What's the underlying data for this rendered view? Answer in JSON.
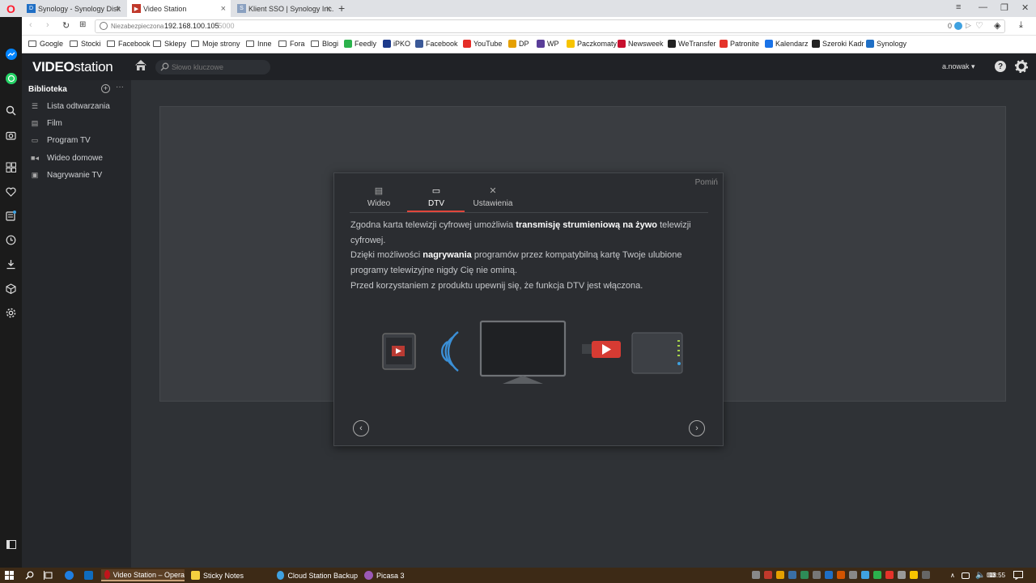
{
  "browser": {
    "tabs": [
      {
        "title": "Synology - Synology Disk",
        "favicon_color": "#1f6fc5"
      },
      {
        "title": "Video Station",
        "favicon_color": "#c0392b"
      },
      {
        "title": "Klient SSO | Synology Inc.",
        "favicon_color": "#8aa0c0"
      }
    ],
    "new_tab": "+",
    "url_security": "Niezabezpieczona",
    "url_host": "192.168.100.105",
    "url_port": ":5000",
    "url_badge": "0",
    "bookmarks": [
      {
        "label": "Google",
        "icon": "folder-icon"
      },
      {
        "label": "Stocki",
        "icon": "folder-icon"
      },
      {
        "label": "Facebook",
        "icon": "folder-icon"
      },
      {
        "label": "Sklepy",
        "icon": "folder-icon"
      },
      {
        "label": "Moje strony",
        "icon": "folder-icon"
      },
      {
        "label": "Inne",
        "icon": "folder-icon"
      },
      {
        "label": "Fora",
        "icon": "folder-icon"
      },
      {
        "label": "Blogi",
        "icon": "folder-icon"
      },
      {
        "label": "Feedly",
        "icon": "feedly-icon",
        "color": "#2bb24c"
      },
      {
        "label": "iPKO",
        "icon": "ipko-icon",
        "color": "#1d3b8b"
      },
      {
        "label": "Facebook",
        "icon": "facebook-icon",
        "color": "#3b5998"
      },
      {
        "label": "YouTube",
        "icon": "youtube-icon",
        "color": "#e52d27"
      },
      {
        "label": "DP",
        "icon": "dp-icon",
        "color": "#e5a000"
      },
      {
        "label": "WP",
        "icon": "wp-icon",
        "color": "#5a3e99"
      },
      {
        "label": "Paczkomaty",
        "icon": "paczkomaty-icon",
        "color": "#f7c400"
      },
      {
        "label": "Newsweek",
        "icon": "newsweek-icon",
        "color": "#c8102e"
      },
      {
        "label": "WeTransfer",
        "icon": "wetransfer-icon",
        "color": "#222222"
      },
      {
        "label": "Patronite",
        "icon": "patronite-icon",
        "color": "#e5332a"
      },
      {
        "label": "Kalendarz",
        "icon": "calendar-icon",
        "color": "#1a73e8"
      },
      {
        "label": "Szeroki Kadr",
        "icon": "szerokikadr-icon",
        "color": "#222222"
      },
      {
        "label": "Synology",
        "icon": "synology-icon",
        "color": "#1f6fc5"
      }
    ]
  },
  "app": {
    "logo_bold": "VIDEO",
    "logo_light": "station",
    "search_placeholder": "Słowo kluczowe",
    "user": "a.nowak ▾",
    "library_title": "Biblioteka",
    "library_items": [
      {
        "label": "Lista odtwarzania",
        "icon": "playlist-icon"
      },
      {
        "label": "Film",
        "icon": "film-icon"
      },
      {
        "label": "Program TV",
        "icon": "tv-icon"
      },
      {
        "label": "Wideo domowe",
        "icon": "camera-icon"
      },
      {
        "label": "Nagrywanie TV",
        "icon": "recording-icon"
      }
    ]
  },
  "dialog": {
    "skip": "Pomiń",
    "tabs": [
      {
        "label": "Wideo",
        "icon": "video-icon"
      },
      {
        "label": "DTV",
        "icon": "tv-icon"
      },
      {
        "label": "Ustawienia",
        "icon": "tools-icon"
      }
    ],
    "active_tab": "DTV",
    "p1_a": "Zgodna karta telewizji cyfrowej umożliwia ",
    "p1_b": "transmisję strumieniową na żywo",
    "p1_c": " telewizji cyfrowej.",
    "p2_a": "Dzięki możliwości ",
    "p2_b": "nagrywania",
    "p2_c": " programów przez kompatybilną kartę Twoje ulubione programy telewizyjne nigdy Cię nie ominą.",
    "p3": "Przed korzystaniem z produktu upewnij się, że funkcja DTV jest włączona."
  },
  "taskbar": {
    "apps": [
      {
        "label": "Video Station – Opera",
        "color": "#c0141b"
      },
      {
        "label": "Sticky Notes",
        "color": "#f4d03f"
      },
      {
        "label": "Cloud Station Backup",
        "color": "#3fa1e0"
      },
      {
        "label": "Picasa 3",
        "color": "#9b59b6"
      }
    ],
    "time": "13:55"
  },
  "colors": {
    "accent": "#e0463c",
    "header_bg": "#202226",
    "content_bg": "#2f3236"
  }
}
